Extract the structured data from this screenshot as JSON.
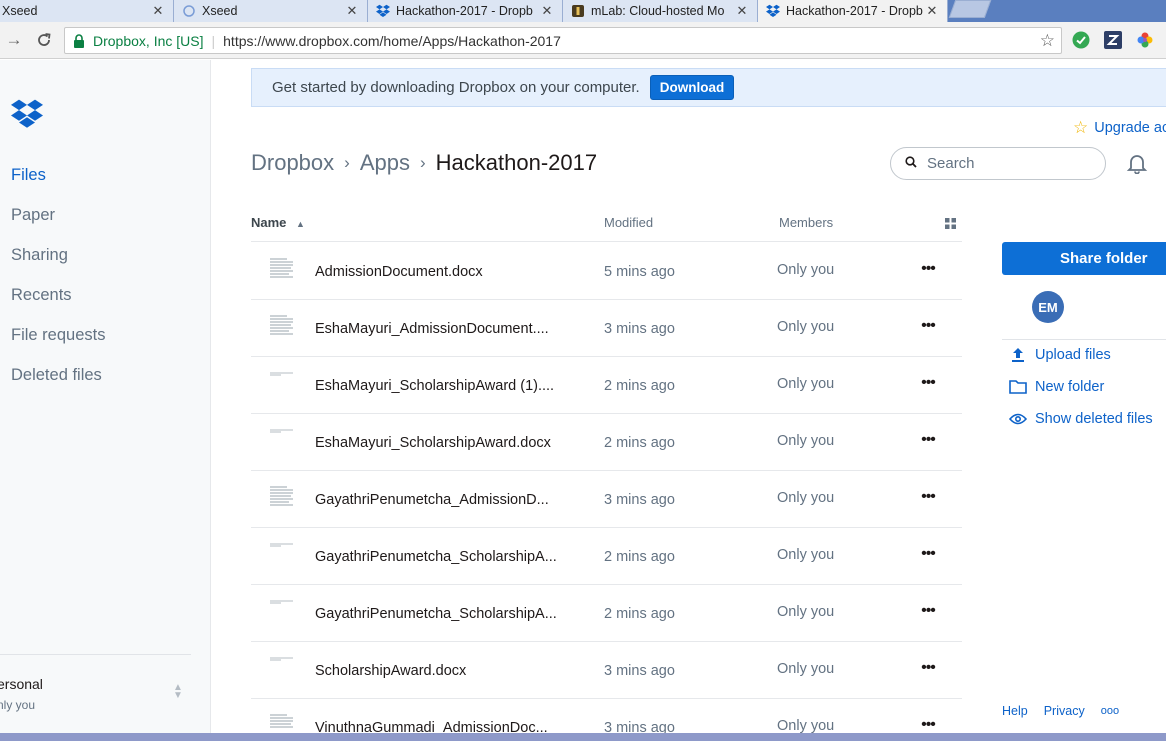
{
  "browser": {
    "tabs": [
      {
        "title": "Xseed",
        "icon": "page-icon"
      },
      {
        "title": "Xseed",
        "icon": "loading-icon"
      },
      {
        "title": "Hackathon-2017 - Dropb",
        "icon": "dropbox-icon"
      },
      {
        "title": "mLab: Cloud-hosted Mo",
        "icon": "mlab-icon"
      },
      {
        "title": "Hackathon-2017 - Dropb",
        "icon": "dropbox-icon",
        "active": true
      }
    ],
    "secure_label": "Dropbox, Inc [US]",
    "url": "https://www.dropbox.com/home/Apps/Hackathon-2017"
  },
  "sidebar": {
    "items": [
      "Files",
      "Paper",
      "Sharing",
      "Recents",
      "File requests",
      "Deleted files"
    ],
    "active": "Files",
    "account_name": "ersonal",
    "account_sub": "nly you"
  },
  "banner": {
    "text": "Get started by downloading Dropbox on your computer.",
    "button": "Download"
  },
  "upgrade": "Upgrade ac",
  "breadcrumb": [
    "Dropbox",
    "Apps",
    "Hackathon-2017"
  ],
  "search": {
    "placeholder": "Search"
  },
  "table": {
    "headers": {
      "name": "Name",
      "modified": "Modified",
      "members": "Members"
    },
    "rows": [
      {
        "name": "AdmissionDocument.docx",
        "modified": "5 mins ago",
        "members": "Only you"
      },
      {
        "name": "EshaMayuri_AdmissionDocument....",
        "modified": "3 mins ago",
        "members": "Only you"
      },
      {
        "name": "EshaMayuri_ScholarshipAward (1)....",
        "modified": "2 mins ago",
        "members": "Only you"
      },
      {
        "name": "EshaMayuri_ScholarshipAward.docx",
        "modified": "2 mins ago",
        "members": "Only you"
      },
      {
        "name": "GayathriPenumetcha_AdmissionD...",
        "modified": "3 mins ago",
        "members": "Only you"
      },
      {
        "name": "GayathriPenumetcha_ScholarshipA...",
        "modified": "2 mins ago",
        "members": "Only you"
      },
      {
        "name": "GayathriPenumetcha_ScholarshipA...",
        "modified": "2 mins ago",
        "members": "Only you"
      },
      {
        "name": "ScholarshipAward.docx",
        "modified": "3 mins ago",
        "members": "Only you"
      },
      {
        "name": "VinuthnaGummadi_AdmissionDoc...",
        "modified": "3 mins ago",
        "members": "Only you"
      }
    ]
  },
  "panel": {
    "share_button": "Share folder",
    "avatar": "EM",
    "actions": [
      "Upload files",
      "New folder",
      "Show deleted files"
    ]
  },
  "footer": {
    "help": "Help",
    "privacy": "Privacy",
    "more": "ooo"
  },
  "colors": {
    "accent": "#0d62c9",
    "button": "#0d6fd6",
    "banner": "#e6f0fd"
  }
}
